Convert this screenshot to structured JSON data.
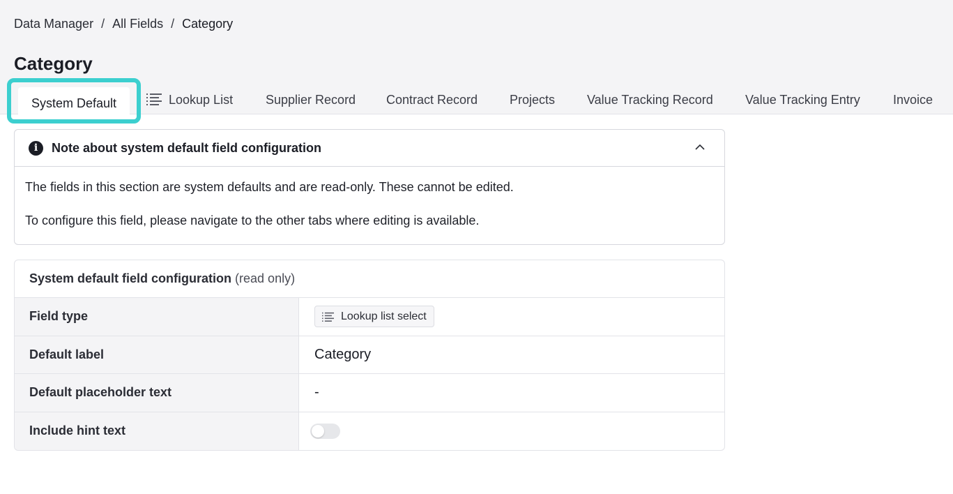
{
  "breadcrumb": {
    "items": [
      "Data Manager",
      "All Fields",
      "Category"
    ],
    "separator": "/"
  },
  "page": {
    "title": "Category"
  },
  "tabs": [
    {
      "label": "System Default",
      "active": true
    },
    {
      "label": "Lookup List",
      "icon": "list-icon"
    },
    {
      "label": "Supplier Record"
    },
    {
      "label": "Contract Record"
    },
    {
      "label": "Projects"
    },
    {
      "label": "Value Tracking Record"
    },
    {
      "label": "Value Tracking Entry"
    },
    {
      "label": "Invoice"
    }
  ],
  "note": {
    "icon": "info-icon",
    "title": "Note about system default field configuration",
    "line1": "The fields in this section are system defaults and are read-only. These cannot be edited.",
    "line2": "To configure this field, please navigate to the other tabs where editing is available.",
    "expanded": true
  },
  "config": {
    "title": "System default field configuration",
    "title_suffix": "(read only)",
    "rows": [
      {
        "label": "Field type",
        "value": "Lookup list select",
        "icon": "list-icon"
      },
      {
        "label": "Default label",
        "value": "Category"
      },
      {
        "label": "Default placeholder text",
        "value": "-"
      },
      {
        "label": "Include hint text",
        "toggle": false
      }
    ]
  },
  "colors": {
    "highlight": "#3ccfcf",
    "header_bg": "#f4f4f6"
  }
}
